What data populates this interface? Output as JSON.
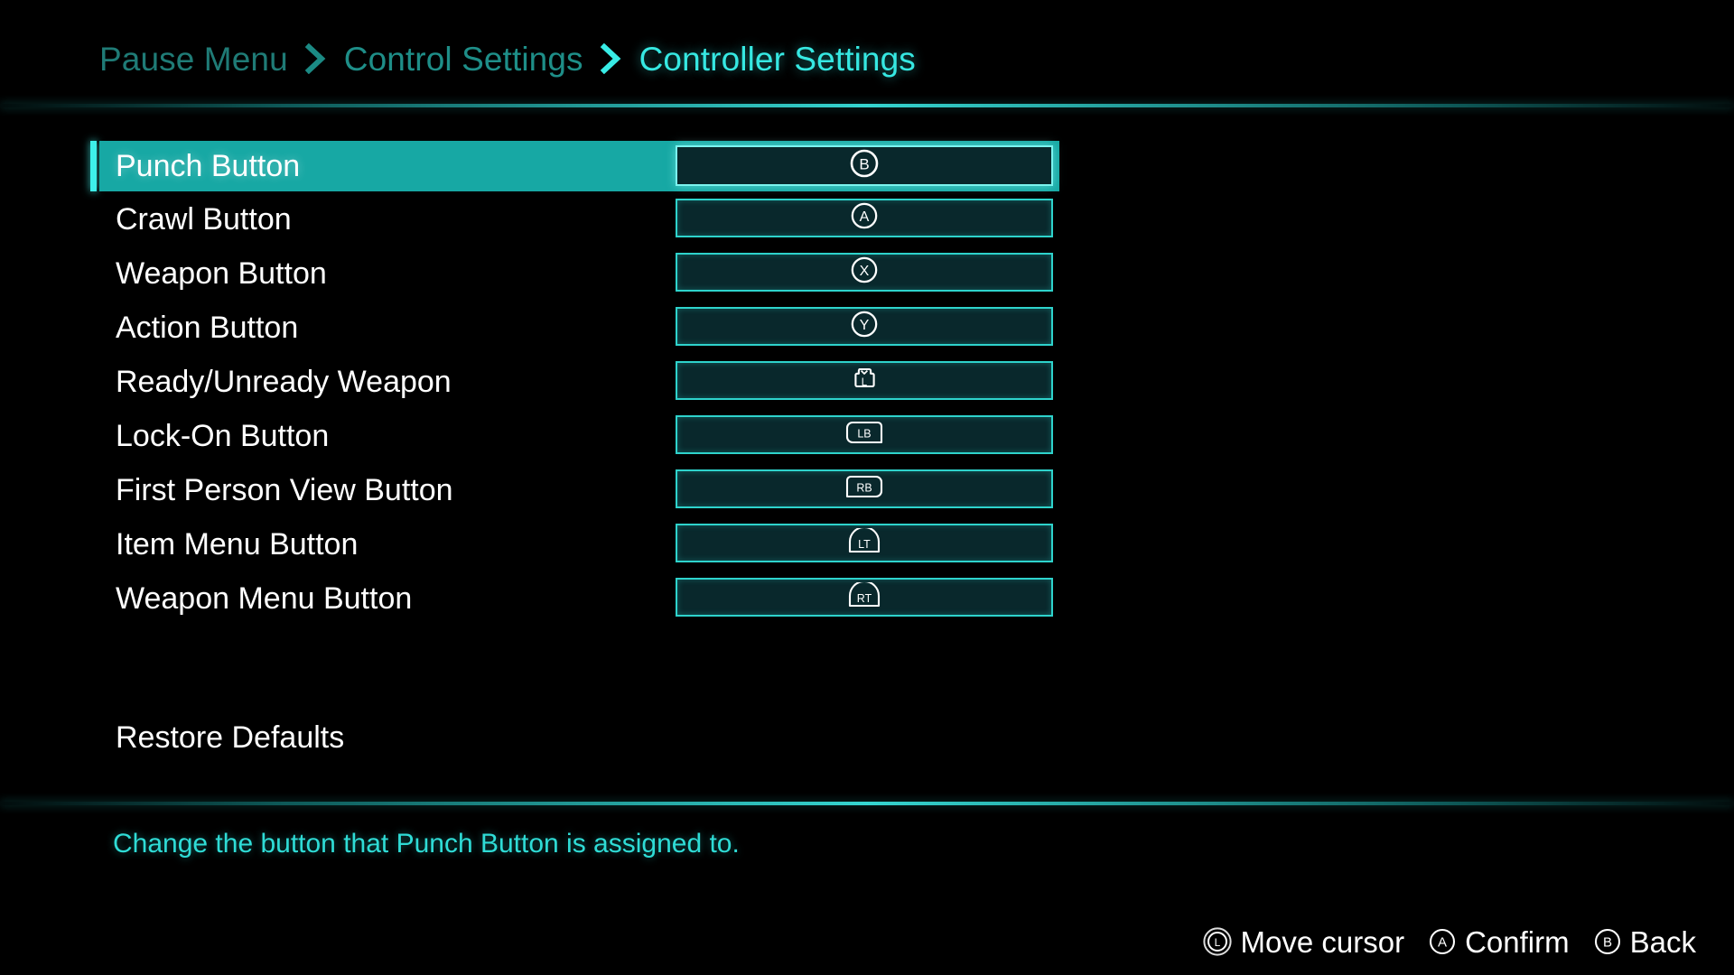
{
  "breadcrumb": {
    "separator_icon": "chevron-right-icon",
    "items": [
      {
        "label": "Pause Menu"
      },
      {
        "label": "Control Settings"
      },
      {
        "label": "Controller Settings"
      }
    ]
  },
  "options": {
    "rows": [
      {
        "label": "Punch Button",
        "binding": "B",
        "binding_icon": "button-b-icon",
        "selected": true
      },
      {
        "label": "Crawl Button",
        "binding": "A",
        "binding_icon": "button-a-icon",
        "selected": false
      },
      {
        "label": "Weapon Button",
        "binding": "X",
        "binding_icon": "button-x-icon",
        "selected": false
      },
      {
        "label": "Action Button",
        "binding": "Y",
        "binding_icon": "button-y-icon",
        "selected": false
      },
      {
        "label": "Ready/Unready Weapon",
        "binding": "L",
        "binding_icon": "left-stick-click-icon",
        "selected": false
      },
      {
        "label": "Lock-On Button",
        "binding": "LB",
        "binding_icon": "bumper-lb-icon",
        "selected": false
      },
      {
        "label": "First Person View Button",
        "binding": "RB",
        "binding_icon": "bumper-rb-icon",
        "selected": false
      },
      {
        "label": "Item Menu Button",
        "binding": "LT",
        "binding_icon": "trigger-lt-icon",
        "selected": false
      },
      {
        "label": "Weapon Menu Button",
        "binding": "RT",
        "binding_icon": "trigger-rt-icon",
        "selected": false
      }
    ]
  },
  "restore_defaults": {
    "label": "Restore Defaults"
  },
  "help": {
    "text": "Change the button that Punch Button is assigned to."
  },
  "hints": {
    "items": [
      {
        "icon": "left-stick-icon",
        "glyph": "L",
        "label": "Move cursor"
      },
      {
        "icon": "button-a-icon",
        "glyph": "A",
        "label": "Confirm"
      },
      {
        "icon": "button-b-icon",
        "glyph": "B",
        "label": "Back"
      }
    ]
  },
  "colors": {
    "background": "#000000",
    "accent_bright": "#3ef0ea",
    "accent_mid": "#2ed3cc",
    "selected_fill": "#17a8a4",
    "value_fill": "#09282c",
    "crumb_dim": "#1f7b76",
    "crumb_active": "#36e8e2",
    "help_text": "#2fdcd6",
    "label_text": "#ffffff"
  }
}
